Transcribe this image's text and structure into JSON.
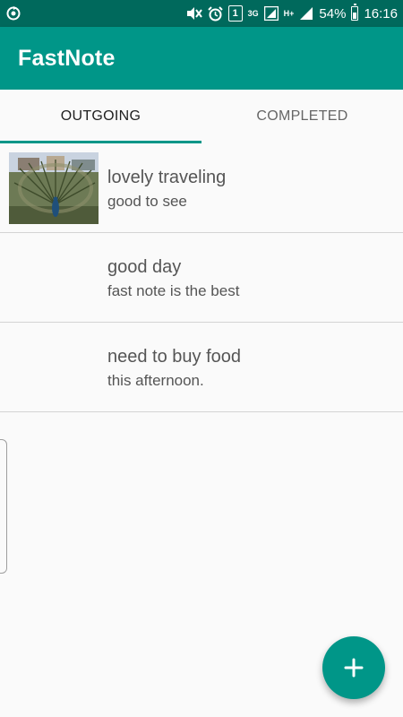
{
  "status_bar": {
    "network_label": "3G",
    "data_label": "H+",
    "sim_slot": "1",
    "battery": "54%",
    "time": "16:16",
    "icons": [
      "sync-icon",
      "mute-icon",
      "alarm-icon",
      "sim-icon",
      "signal-icon",
      "battery-icon"
    ]
  },
  "app": {
    "title": "FastNote",
    "theme_icon": "moon-icon",
    "primary_color": "#009688",
    "status_color": "#00695c"
  },
  "tabs": [
    {
      "label": "OUTGOING",
      "active": true
    },
    {
      "label": "COMPLETED",
      "active": false
    }
  ],
  "notes": [
    {
      "title": "lovely traveling",
      "subtitle": "good to see",
      "has_image": true
    },
    {
      "title": "good day",
      "subtitle": "fast note is the best",
      "has_image": false
    },
    {
      "title": "need to buy food",
      "subtitle": "this afternoon.",
      "has_image": false
    }
  ],
  "fab": {
    "icon": "plus-icon"
  }
}
